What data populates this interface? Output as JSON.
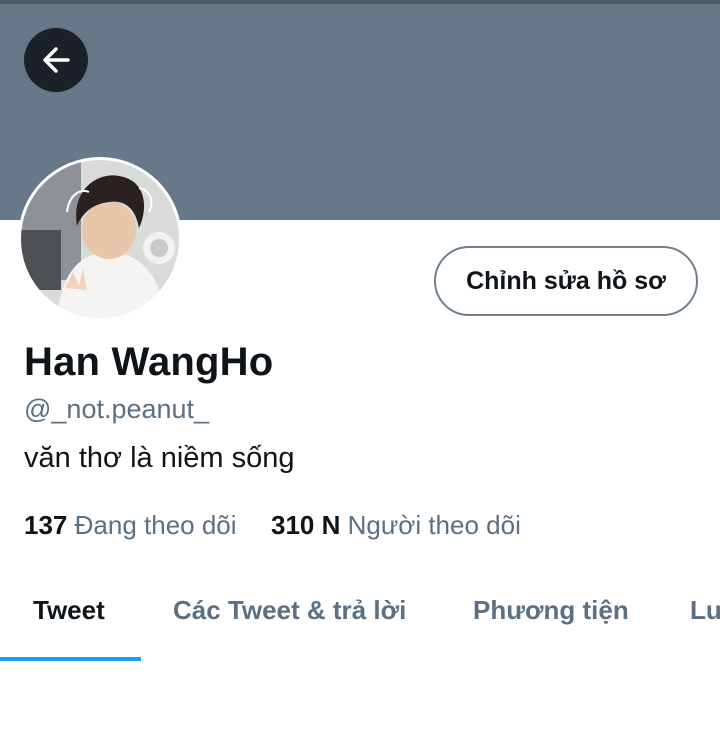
{
  "header": {
    "back_icon": "arrow-left-icon"
  },
  "colors": {
    "banner": "#66788a",
    "accent": "#1d9bf0",
    "text_primary": "#0f1419",
    "text_secondary": "#5b7083"
  },
  "profile": {
    "avatar_icon": "profile-photo",
    "edit_button_label": "Chỉnh sửa hồ sơ",
    "display_name": "Han WangHo",
    "handle": "@_not.peanut_",
    "bio": "văn thơ là niềm sống",
    "following_count": "137",
    "following_label": "Đang theo dõi",
    "followers_count": "310 N",
    "followers_label": "Người theo dõi"
  },
  "tabs": [
    {
      "label": "Tweet",
      "active": true
    },
    {
      "label": "Các Tweet & trả lời",
      "active": false
    },
    {
      "label": "Phương tiện",
      "active": false
    },
    {
      "label": "Lu",
      "active": false
    }
  ]
}
